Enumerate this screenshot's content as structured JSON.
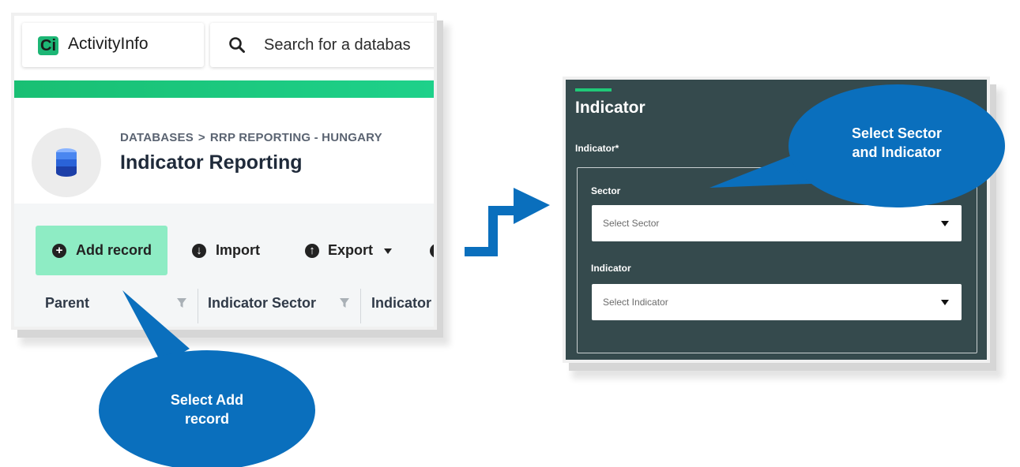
{
  "app": {
    "logo_letter": "Ci",
    "name": "ActivityInfo",
    "brand_color": "#1db675"
  },
  "search": {
    "placeholder": "Search for a databas"
  },
  "breadcrumb": {
    "items": [
      "DATABASES",
      "RRP REPORTING - HUNGARY"
    ],
    "separator": ">"
  },
  "page": {
    "title": "Indicator Reporting"
  },
  "toolbar": {
    "add_record": "Add record",
    "import": "Import",
    "export": "Export"
  },
  "grid": {
    "columns": [
      "Parent",
      "Indicator Sector",
      "Indicator"
    ]
  },
  "form": {
    "section_title": "Indicator",
    "field_label": "Indicator*",
    "sector_label": "Sector",
    "sector_placeholder": "Select Sector",
    "indicator_label": "Indicator",
    "indicator_placeholder": "Select Indicator",
    "panel_color": "#354a4d",
    "accent_color": "#20c978"
  },
  "callouts": {
    "add_record_line1": "Select Add",
    "add_record_line2": "record",
    "sector_line1": "Select Sector",
    "sector_line2": "and  Indicator",
    "color": "#0a6fbd"
  }
}
